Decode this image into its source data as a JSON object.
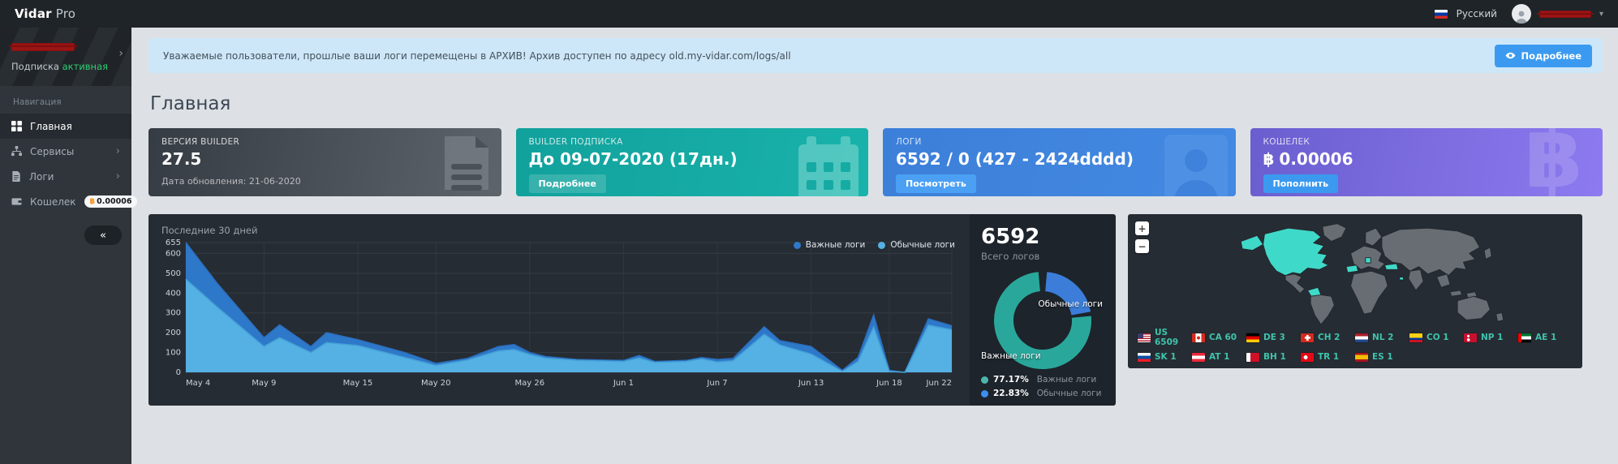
{
  "app": {
    "brand_bold": "Vidar",
    "brand_light": "Pro"
  },
  "topbar": {
    "language": "Русский",
    "caret": "▾"
  },
  "sidebar": {
    "subscription_prefix": "Подписка",
    "subscription_status": "активная",
    "nav_header": "Навигация",
    "items": [
      {
        "icon": "grid-icon",
        "label": "Главная",
        "active": true,
        "chevron": false,
        "badge": null
      },
      {
        "icon": "sitemap-icon",
        "label": "Сервисы",
        "active": false,
        "chevron": true,
        "badge": null
      },
      {
        "icon": "file-icon",
        "label": "Логи",
        "active": false,
        "chevron": true,
        "badge": null
      },
      {
        "icon": "wallet-icon",
        "label": "Кошелек",
        "active": false,
        "chevron": false,
        "badge": "0.00006",
        "badge_currency": "฿"
      }
    ],
    "collapse": "«"
  },
  "alert": {
    "text": "Уважаемые пользователи, прошлые ваши логи перемещены в АРХИВ! Архив доступен по адресу old.my-vidar.com/logs/all",
    "button": "Подробнее"
  },
  "page": {
    "title": "Главная"
  },
  "cards": [
    {
      "label": "ВЕРСИЯ BUILDER",
      "value": "27.5",
      "sub": "Дата обновления: 21-06-2020"
    },
    {
      "label": "BUILDER ПОДПИСКА",
      "value": "До 09-07-2020 (17дн.)",
      "button": "Подробнее"
    },
    {
      "label": "ЛОГИ",
      "value": "6592 / 0 (427 - 2424dddd)",
      "button": "Посмотреть"
    },
    {
      "label": "КОШЕЛЕК",
      "value": "0.00006",
      "currency": "฿",
      "button": "Пополнить"
    }
  ],
  "chart_data": [
    {
      "type": "area",
      "title": "Последние 30 дней",
      "ylim": [
        0,
        655
      ],
      "y_ticks": [
        0,
        100,
        200,
        300,
        400,
        500,
        600,
        655
      ],
      "x_ticks": [
        {
          "d": 0,
          "label": "May 4"
        },
        {
          "d": 5,
          "label": "May 9"
        },
        {
          "d": 11,
          "label": "May 15"
        },
        {
          "d": 16,
          "label": "May 20"
        },
        {
          "d": 22,
          "label": "May 26"
        },
        {
          "d": 28,
          "label": "Jun 1"
        },
        {
          "d": 34,
          "label": "Jun 7"
        },
        {
          "d": 40,
          "label": "Jun 13"
        },
        {
          "d": 45,
          "label": "Jun 18"
        },
        {
          "d": 49,
          "label": "Jun 22"
        }
      ],
      "series": [
        {
          "name": "Важные логи",
          "color": "#2e78c9"
        },
        {
          "name": "Обычные логи",
          "color": "#55b0e4"
        }
      ],
      "points": [
        {
          "d": 0,
          "regular": 470,
          "important": 185
        },
        {
          "d": 2,
          "regular": 330,
          "important": 120
        },
        {
          "d": 5,
          "regular": 130,
          "important": 45
        },
        {
          "d": 6,
          "regular": 175,
          "important": 65
        },
        {
          "d": 8,
          "regular": 100,
          "important": 30
        },
        {
          "d": 9,
          "regular": 150,
          "important": 50
        },
        {
          "d": 11,
          "regular": 135,
          "important": 30
        },
        {
          "d": 14,
          "regular": 75,
          "important": 25
        },
        {
          "d": 16,
          "regular": 35,
          "important": 10
        },
        {
          "d": 18,
          "regular": 62,
          "important": 8
        },
        {
          "d": 20,
          "regular": 108,
          "important": 22
        },
        {
          "d": 21,
          "regular": 115,
          "important": 25
        },
        {
          "d": 22,
          "regular": 90,
          "important": 10
        },
        {
          "d": 23,
          "regular": 72,
          "important": 8
        },
        {
          "d": 25,
          "regular": 60,
          "important": 5
        },
        {
          "d": 28,
          "regular": 55,
          "important": 5
        },
        {
          "d": 29,
          "regular": 72,
          "important": 13
        },
        {
          "d": 30,
          "regular": 50,
          "important": 5
        },
        {
          "d": 32,
          "regular": 55,
          "important": 5
        },
        {
          "d": 33,
          "regular": 68,
          "important": 7
        },
        {
          "d": 34,
          "regular": 52,
          "important": 13
        },
        {
          "d": 35,
          "regular": 58,
          "important": 12
        },
        {
          "d": 37,
          "regular": 192,
          "important": 38
        },
        {
          "d": 38,
          "regular": 138,
          "important": 22
        },
        {
          "d": 40,
          "regular": 92,
          "important": 38
        },
        {
          "d": 42,
          "regular": 5,
          "important": 5
        },
        {
          "d": 43,
          "regular": 55,
          "important": 20
        },
        {
          "d": 44,
          "regular": 228,
          "important": 62
        },
        {
          "d": 45,
          "regular": 5,
          "important": 5
        },
        {
          "d": 46,
          "regular": 0,
          "important": 0
        },
        {
          "d": 47.5,
          "regular": 238,
          "important": 32
        },
        {
          "d": 49,
          "regular": 215,
          "important": 20
        }
      ]
    },
    {
      "type": "donut",
      "slices": [
        {
          "label": "Важные логи",
          "value": 77.17,
          "color": "#2aa79b"
        },
        {
          "label": "Обычные логи",
          "value": 22.83,
          "color": "#3b7dd8"
        }
      ]
    }
  ],
  "stats": {
    "total": "6592",
    "subtitle": "Всего логов",
    "donut_label_regular": "Обычные логи",
    "donut_label_important": "Важные логи",
    "legend": [
      {
        "pct": "77.17%",
        "label": "Важные логи",
        "color": "#4db6ac"
      },
      {
        "pct": "22.83%",
        "label": "Обычные логи",
        "color": "#3b8df0"
      }
    ]
  },
  "map": {
    "zoom_in": "+",
    "zoom_out": "−",
    "countries": [
      {
        "code": "US",
        "count": "6509"
      },
      {
        "code": "CA",
        "count": "60"
      },
      {
        "code": "DE",
        "count": "3"
      },
      {
        "code": "CH",
        "count": "2"
      },
      {
        "code": "NL",
        "count": "2"
      },
      {
        "code": "CO",
        "count": "1"
      },
      {
        "code": "NP",
        "count": "1"
      },
      {
        "code": "AE",
        "count": "1"
      },
      {
        "code": "SK",
        "count": "1"
      },
      {
        "code": "AT",
        "count": "1"
      },
      {
        "code": "BH",
        "count": "1"
      },
      {
        "code": "TR",
        "count": "1"
      },
      {
        "code": "ES",
        "count": "1"
      }
    ]
  }
}
